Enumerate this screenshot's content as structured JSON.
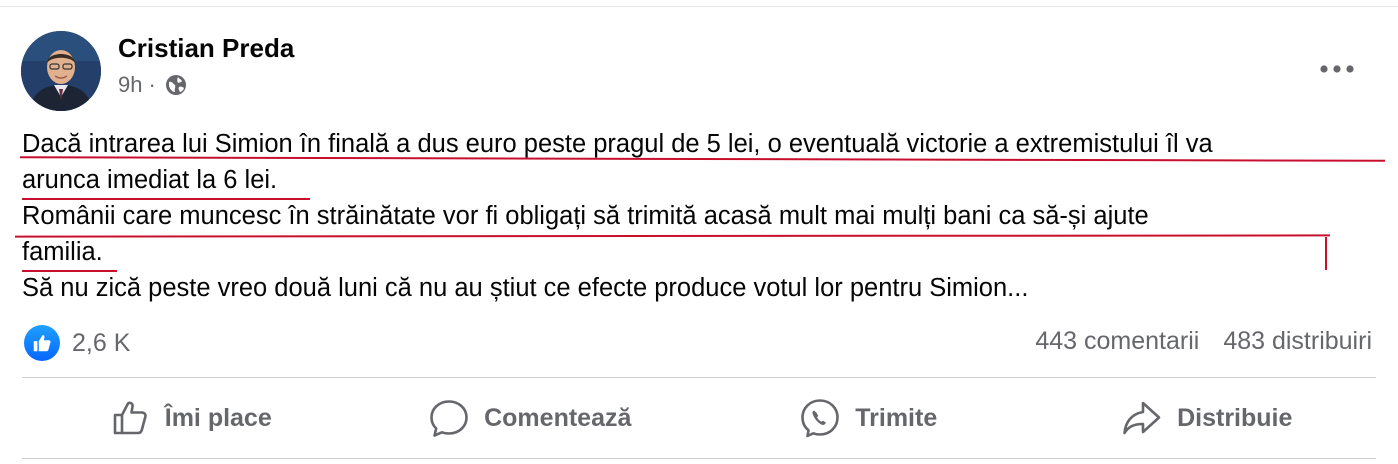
{
  "post": {
    "author": "Cristian Preda",
    "time": "9h",
    "separator": "·",
    "lines": [
      "Dacă intrarea lui Simion în finală a dus euro peste pragul de 5 lei, o eventuală victorie a extremistului îl va",
      "arunca imediat la 6 lei.",
      "Românii care muncesc în străinătate vor fi obligați să trimită acasă mult mai mulți bani ca să-și ajute",
      "familia.",
      "Să nu zică peste vreo două luni că nu au știut ce efecte produce votul lor pentru Simion..."
    ]
  },
  "stats": {
    "likes": "2,6 K",
    "comments": "443 comentarii",
    "shares": "483 distribuiri"
  },
  "actions": {
    "like": "Îmi place",
    "comment": "Comentează",
    "send": "Trimite",
    "share": "Distribuie"
  },
  "colors": {
    "annotation": "#c8102e",
    "like_blue": "#0866ff",
    "muted_text": "#65676b"
  },
  "icons": [
    "avatar-photo",
    "globe-icon",
    "more-options-icon",
    "like-reaction-icon",
    "thumbs-up-icon",
    "comment-icon",
    "messenger-icon",
    "share-icon"
  ]
}
